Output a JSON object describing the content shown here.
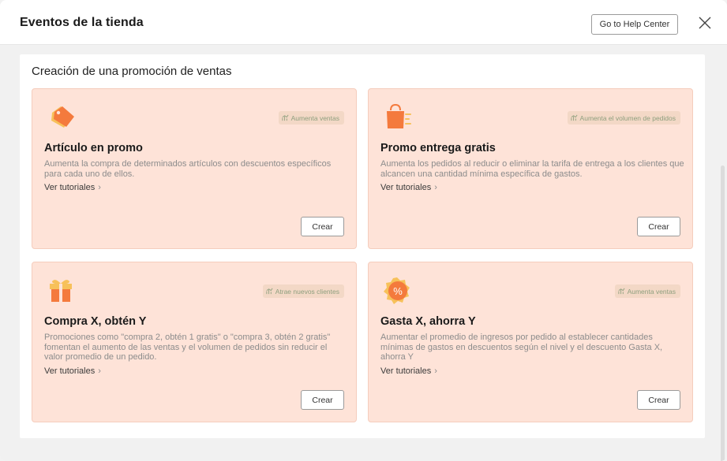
{
  "header": {
    "title": "Eventos de la tienda",
    "help_button": "Go to Help Center",
    "close_icon": "close-icon"
  },
  "section": {
    "title": "Creación de una promoción de ventas"
  },
  "cards": [
    {
      "icon": "tag-icon",
      "badge": "Aumenta ventas",
      "title": "Artículo en promo",
      "description": "Aumenta la compra de determinados artículos con descuentos específicos para cada uno de ellos.",
      "tutorial_link": "Ver tutoriales",
      "create_button": "Crear"
    },
    {
      "icon": "shopping-bag-icon",
      "badge": "Aumenta el volumen de pedidos",
      "title": "Promo entrega gratis",
      "description": "Aumenta los pedidos al reducir o eliminar la tarifa de entrega a los clientes que alcancen una cantidad mínima específica de gastos.",
      "tutorial_link": "Ver tutoriales",
      "create_button": "Crear"
    },
    {
      "icon": "gift-icon",
      "badge": "Atrae nuevos clientes",
      "title": "Compra X, obtén Y",
      "description": "Promociones como \"compra 2, obtén 1 gratis\" o \"compra 3, obtén 2 gratis\" fomentan el aumento de las ventas y el volumen de pedidos sin reducir el valor promedio de un pedido.",
      "tutorial_link": "Ver tutoriales",
      "create_button": "Crear"
    },
    {
      "icon": "percent-badge-icon",
      "badge": "Aumenta ventas",
      "title": "Gasta X, ahorra Y",
      "description": "Aumentar el promedio de ingresos por pedido al establecer cantidades mínimas de gastos en descuentos según el nivel y el descuento Gasta X, ahorra Y",
      "tutorial_link": "Ver tutoriales",
      "create_button": "Crear"
    }
  ],
  "colors": {
    "card_background": "#fee3d8",
    "accent_orange": "#f47a3d",
    "badge_text": "#8e9f7e"
  }
}
